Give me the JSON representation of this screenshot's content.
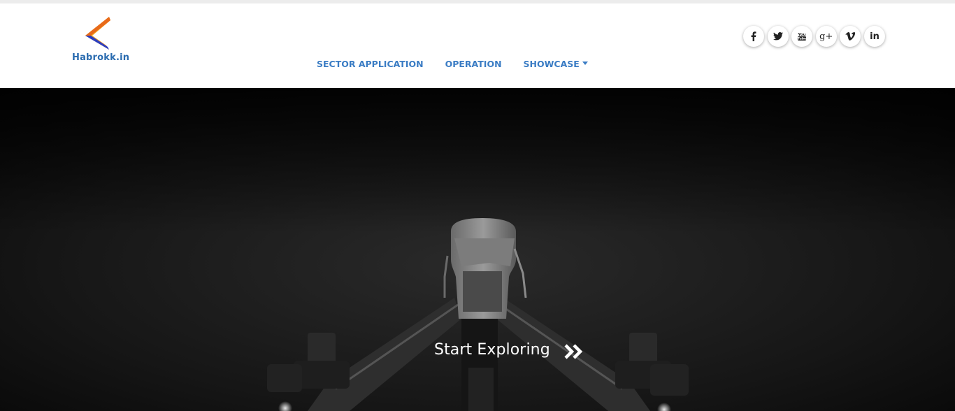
{
  "brand": {
    "name": "Habrokk.in",
    "colors": {
      "logo_orange": "#f5a623",
      "logo_blue": "#2b3fc1",
      "logo_yellow": "#ffd21e",
      "nav_blue": "#3a7cc4"
    }
  },
  "nav": {
    "items": [
      {
        "label": "SECTOR APPLICATION"
      },
      {
        "label": "OPERATION"
      },
      {
        "label": "SHOWCASE",
        "has_dropdown": true
      }
    ]
  },
  "social": {
    "items": [
      {
        "icon": "facebook-icon"
      },
      {
        "icon": "twitter-icon"
      },
      {
        "icon": "youtube-icon"
      },
      {
        "icon": "google-plus-icon",
        "label": "g+"
      },
      {
        "icon": "vimeo-icon"
      },
      {
        "icon": "linkedin-icon",
        "label": "in"
      }
    ]
  },
  "hero": {
    "cta_label": "Start Exploring",
    "cta_icon": "double-chevron-right-icon"
  }
}
